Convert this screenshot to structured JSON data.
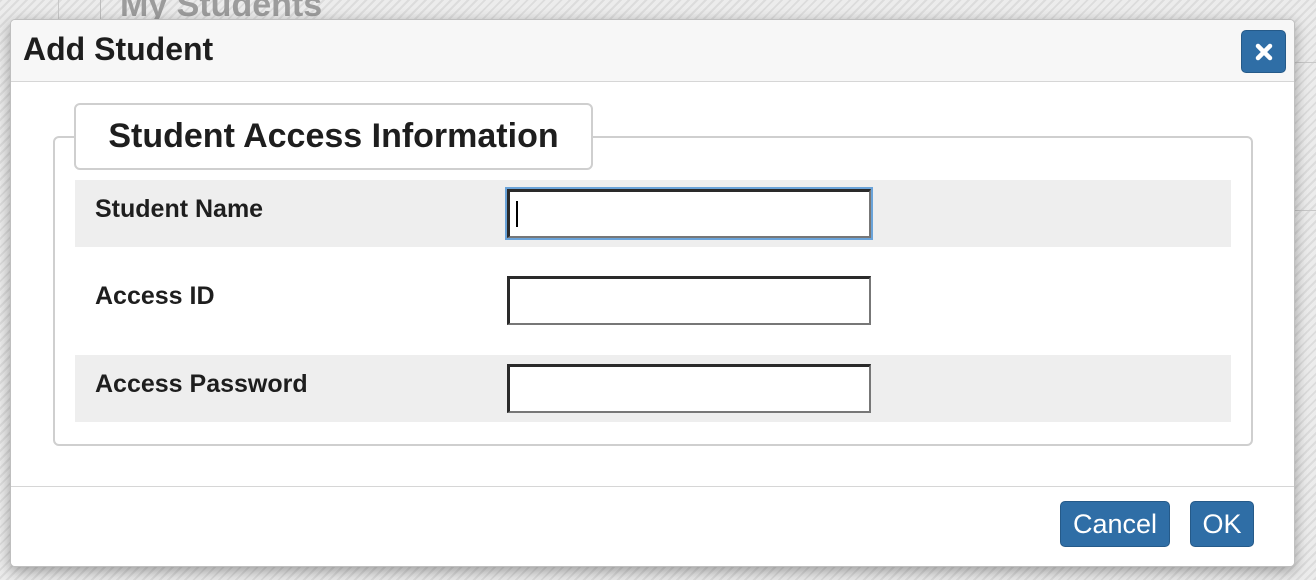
{
  "background": {
    "page_title": "My Students"
  },
  "dialog": {
    "title": "Add Student",
    "close_icon": "close-icon",
    "accent_color": "#2f6ea6"
  },
  "section": {
    "legend": "Student Access Information"
  },
  "fields": [
    {
      "label": "Student Name",
      "value": "",
      "focused": true
    },
    {
      "label": "Access ID",
      "value": ""
    },
    {
      "label": "Access Password",
      "value": ""
    }
  ],
  "footer": {
    "cancel_label": "Cancel",
    "ok_label": "OK"
  }
}
